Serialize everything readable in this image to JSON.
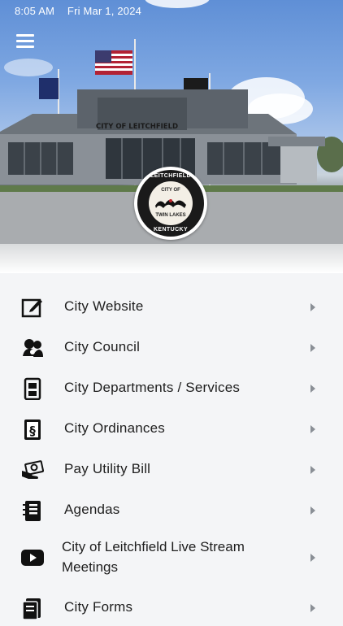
{
  "status_bar": {
    "time": "8:05 AM",
    "date": "Fri Mar 1, 2024"
  },
  "header": {
    "building_sign": "CITY OF LEITCHFIELD",
    "seal": {
      "top": "LEITCHFIELD",
      "inner_top": "CITY OF",
      "inner_bottom": "TWIN LAKES",
      "bottom": "KENTUCKY"
    }
  },
  "menu": {
    "items": [
      {
        "label": "City Website",
        "icon": "edit-icon"
      },
      {
        "label": "City Council",
        "icon": "council-icon"
      },
      {
        "label": "City Departments / Services",
        "icon": "building-icon"
      },
      {
        "label": "City Ordinances",
        "icon": "ordinance-icon"
      },
      {
        "label": "Pay Utility Bill",
        "icon": "cash-icon"
      },
      {
        "label": "Agendas",
        "icon": "notebook-icon"
      },
      {
        "label": "City of Leitchfield Live Stream Meetings",
        "line1": "City of Leitchfield Live Stream",
        "line2": "Meetings",
        "icon": "youtube-icon"
      },
      {
        "label": "City Forms",
        "icon": "forms-icon"
      }
    ]
  },
  "colors": {
    "background": "#f4f5f7",
    "text": "#1e1e1e",
    "chevron": "#8a8f96",
    "icon": "#111111"
  }
}
